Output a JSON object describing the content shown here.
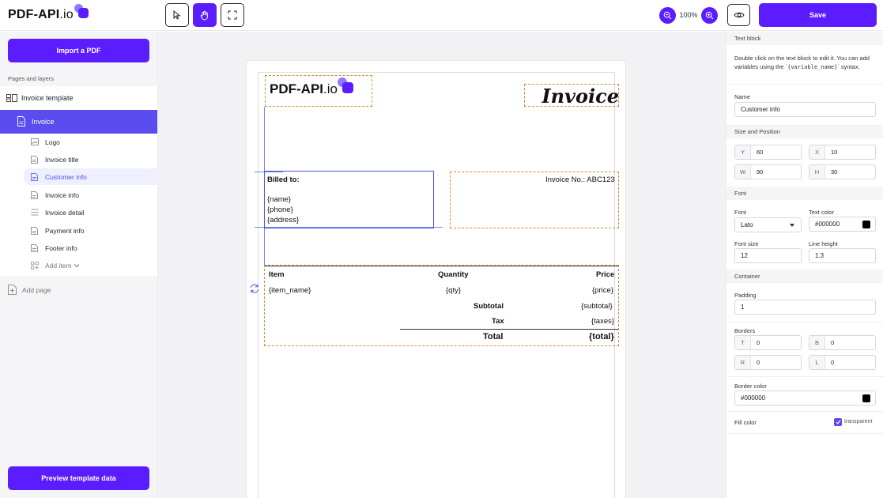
{
  "app": {
    "logo_text": "PDF-API",
    "logo_suffix": ".io"
  },
  "toolbar": {
    "zoom_label": "100%",
    "save_label": "Save"
  },
  "left": {
    "import_label": "Import a PDF",
    "section_title": "Pages and layers",
    "template_label": "Invoice template",
    "page_label": "Invoice",
    "layers": [
      "Logo",
      "Invoice title",
      "Customer info",
      "Invoice info",
      "Invoice detail",
      "Payment info",
      "Footer info"
    ],
    "add_item_label": "Add item",
    "add_page_label": "Add page",
    "preview_label": "Preview template data"
  },
  "canvas": {
    "invoice_title": "Invoice",
    "billed_to": "Billed to:",
    "name_var": "{name}",
    "phone_var": "{phone}",
    "address_var": "{address}",
    "invoice_no": "Invoice No.: ABC123",
    "col_item": "Item",
    "col_quantity": "Quantity",
    "col_price": "Price",
    "item_var": "{item_name}",
    "qty_var": "{qty}",
    "price_var": "{price}",
    "subtotal_label": "Subtotal",
    "subtotal_var": "{subtotal}",
    "tax_label": "Tax",
    "taxes_var": "{taxes}",
    "total_label": "Total",
    "total_var": "{total}"
  },
  "right": {
    "text_block_head": "Text block",
    "help_pre": "Double click on the text block to edit it. You can add variables using the `",
    "help_code": "{variable_name}",
    "help_post": "` syntax.",
    "name_label": "Name",
    "name_value": "Customer info",
    "size_pos_head": "Size and Position",
    "y_label": "Y",
    "y_value": "60",
    "x_label": "X",
    "x_value": "10",
    "w_label": "W",
    "w_value": "90",
    "h_label": "H",
    "h_value": "30",
    "font_head": "Font",
    "font_label": "Font",
    "font_value": "Lato",
    "text_color_label": "Text color",
    "text_color_value": "#000000",
    "font_size_label": "Font size",
    "font_size_value": "12",
    "line_height_label": "Line height",
    "line_height_value": "1.3",
    "container_head": "Container",
    "padding_label": "Padding",
    "padding_value": "1",
    "borders_label": "Borders",
    "t_label": "T",
    "t_value": "0",
    "b_label": "B",
    "b_value": "0",
    "r_label": "R",
    "r_value": "0",
    "l_label": "L",
    "l_value": "0",
    "border_color_label": "Border color",
    "border_color_value": "#000000",
    "fill_color_label": "Fill color",
    "transparent_label": "transparent"
  },
  "colors": {
    "accent": "#5b1dff",
    "selected_row": "#5b4cf0",
    "dashed_outline": "#d98b2b"
  }
}
